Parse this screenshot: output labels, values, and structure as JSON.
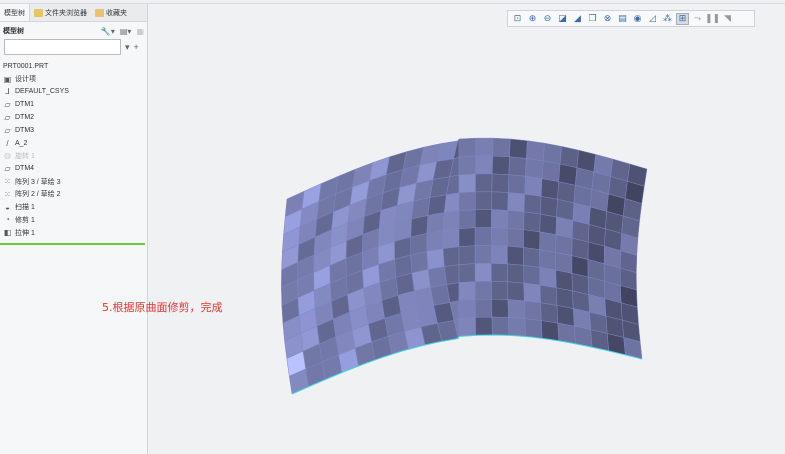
{
  "tabs": [
    {
      "label": "模型树",
      "icon": "model-tree-icon"
    },
    {
      "label": "文件夹浏览器",
      "icon": "folder-icon"
    },
    {
      "label": "收藏夹",
      "icon": "favorites-icon"
    }
  ],
  "panel_title": "模型树",
  "search": {
    "value": "",
    "clear": "×",
    "add": "+"
  },
  "tree": [
    {
      "label": "PRT0001.PRT",
      "icon": ""
    },
    {
      "label": "设计项",
      "icon": "design-item-icon"
    },
    {
      "label": "DEFAULT_CSYS",
      "icon": "csys-icon"
    },
    {
      "label": "DTM1",
      "icon": "datum-plane-icon"
    },
    {
      "label": "DTM2",
      "icon": "datum-plane-icon"
    },
    {
      "label": "DTM3",
      "icon": "datum-plane-icon"
    },
    {
      "label": "A_2",
      "icon": "axis-icon"
    },
    {
      "label": "旋转 1",
      "icon": "revolve-icon",
      "suppressed": true
    },
    {
      "label": "DTM4",
      "icon": "datum-plane-icon"
    },
    {
      "label": "阵列 3 / 草绘 3",
      "icon": "pattern-icon"
    },
    {
      "label": "阵列 2 / 草绘 2",
      "icon": "pattern-icon"
    },
    {
      "label": "扫描 1",
      "icon": "sweep-icon"
    },
    {
      "label": "修剪 1",
      "icon": "trim-icon"
    },
    {
      "label": "拉伸 1",
      "icon": "extrude-icon"
    }
  ],
  "toolbar": [
    "refit",
    "zoom-in",
    "zoom-out",
    "repaint",
    "display-style",
    "saved-views",
    "view-manager",
    "perspective",
    "section",
    "datum-display",
    "annotation",
    "spin-center",
    "model-snap",
    "pause",
    "last-view"
  ],
  "annotation": "5.根据原曲面修剪，完成",
  "colors": {
    "model": "#a4acf0",
    "accent": "#6ccc3a",
    "note": "#e8352f"
  }
}
